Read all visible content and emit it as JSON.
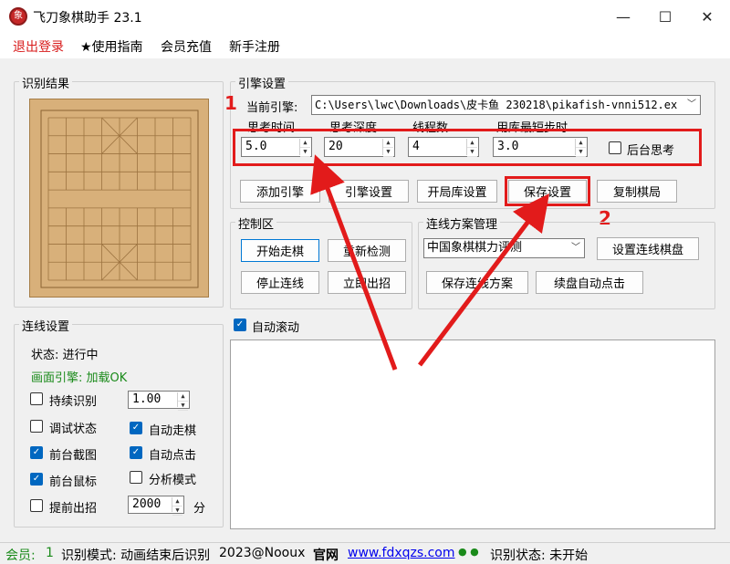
{
  "window": {
    "icon_char": "象",
    "title": "飞刀象棋助手 23.1",
    "minimize": "—",
    "maximize": "☐",
    "close": "✕"
  },
  "menu": {
    "logout": "退出登录",
    "guide": "★使用指南",
    "recharge": "会员充值",
    "register": "新手注册"
  },
  "recognition": {
    "title": "识别结果"
  },
  "engine": {
    "title": "引擎设置",
    "current_label": "当前引擎:",
    "current_value": "C:\\Users\\lwc\\Downloads\\皮卡鱼 230218\\pikafish-vnni512.ex",
    "think_time_label": "思考时间",
    "think_time": "5.0",
    "think_depth_label": "思考深度",
    "think_depth": "20",
    "threads_label": "线程数",
    "threads": "4",
    "db_label": "用库最短步时",
    "db_value": "3.0",
    "ponder_label": "后台思考",
    "btn_add": "添加引擎",
    "btn_settings": "引擎设置",
    "btn_opening": "开局库设置",
    "btn_save": "保存设置",
    "btn_copy": "复制棋局"
  },
  "control": {
    "title": "控制区",
    "btn_start": "开始走棋",
    "btn_recheck": "重新检测",
    "btn_stop": "停止连线",
    "btn_move_now": "立即出招"
  },
  "scheme": {
    "title": "连线方案管理",
    "selected": "中国象棋棋力评测",
    "btn_set_board": "设置连线棋盘",
    "btn_save_scheme": "保存连线方案",
    "btn_continue": "续盘自动点击"
  },
  "link": {
    "title": "连线设置",
    "status": "状态: 进行中",
    "engine_status": "画面引擎: 加载OK",
    "continuous": "持续识别",
    "continuous_value": "1.00",
    "debug": "调试状态",
    "auto_move": "自动走棋",
    "front_capture": "前台截图",
    "auto_click": "自动点击",
    "front_mouse": "前台鼠标",
    "analysis": "分析模式",
    "early_move": "提前出招",
    "early_value": "2000",
    "early_unit": "分"
  },
  "log": {
    "auto_scroll": "自动滚动"
  },
  "status": {
    "member_label": "会员:",
    "member_value": "1",
    "mode": "识别模式: 动画结束后识别",
    "copyright": "2023@Nooux",
    "site_label": "官网",
    "site_url": "www.fdxqzs.com",
    "dots": "● ●",
    "recog_status": "识别状态: 未开始"
  },
  "annotations": {
    "label_1": "1",
    "label_2": "2"
  },
  "colors": {
    "accent": "#0067c0",
    "annotation": "#e21b1b",
    "logout": "#d81b1b",
    "board": "#d8b07a",
    "engine_ok": "#1a8a1a"
  }
}
